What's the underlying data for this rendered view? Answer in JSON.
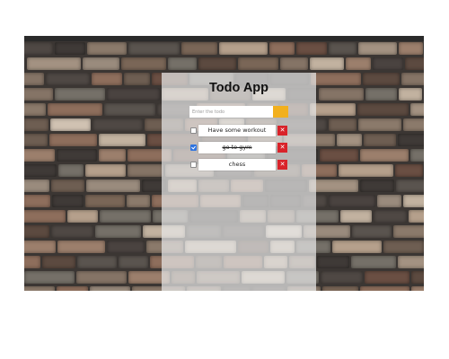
{
  "app": {
    "title": "Todo App",
    "input_placeholder": "Enter the todo",
    "add_button_color": "#f2b01e",
    "delete_button_color": "#d9232a",
    "delete_icon": "close-icon",
    "delete_glyph": "✕"
  },
  "todos": [
    {
      "text": "Have some workout",
      "completed": false
    },
    {
      "text": "go to gym",
      "completed": true
    },
    {
      "text": "chess",
      "completed": false
    }
  ]
}
